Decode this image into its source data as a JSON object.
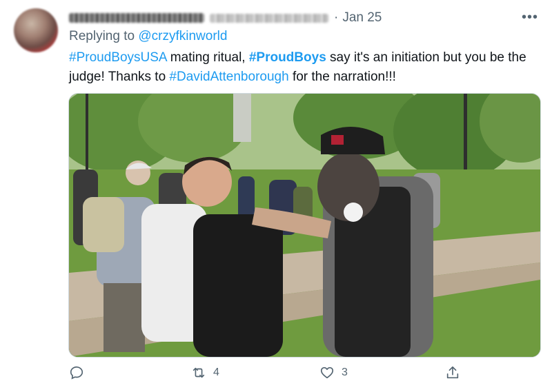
{
  "tweet": {
    "date": "Jan 25",
    "separator": "·",
    "more_label": "•••",
    "reply_prefix": "Replying to",
    "reply_to": "@crzyfkinworld",
    "text": {
      "tag1": "#ProudBoysUSA",
      "part1": " mating ritual, ",
      "tag2": "#ProudBoys",
      "part2": " say it's an initiation but you be the judge! Thanks to ",
      "tag3": "#DavidAttenborough",
      "part3": " for the narration!!!"
    }
  },
  "actions": {
    "replies": "",
    "retweets": "4",
    "likes": "3"
  },
  "colors": {
    "link": "#1d9bf0",
    "muted": "#536471",
    "text": "#0f1419"
  },
  "icons": [
    "reply-icon",
    "retweet-icon",
    "like-icon",
    "share-icon",
    "more-icon"
  ]
}
